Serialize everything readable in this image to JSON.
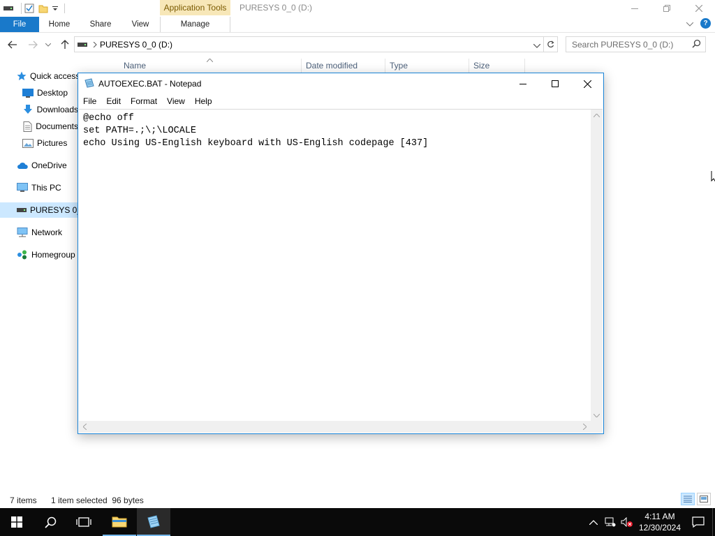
{
  "explorer": {
    "title": "PURESYS 0_0 (D:)",
    "contextual_tab": "Application Tools",
    "ribbon_tabs": [
      "File",
      "Home",
      "Share",
      "View",
      "Manage"
    ],
    "address": "PURESYS 0_0 (D:)",
    "search_placeholder": "Search PURESYS 0_0 (D:)",
    "columns": [
      "Name",
      "Date modified",
      "Type",
      "Size"
    ],
    "nav_items": [
      {
        "label": "Quick access",
        "icon": "star-icon"
      },
      {
        "label": "Desktop",
        "icon": "desktop-icon"
      },
      {
        "label": "Downloads",
        "icon": "download-icon"
      },
      {
        "label": "Documents",
        "icon": "documents-icon"
      },
      {
        "label": "Pictures",
        "icon": "pictures-icon"
      },
      {
        "label": "OneDrive",
        "icon": "cloud-icon"
      },
      {
        "label": "This PC",
        "icon": "computer-icon"
      },
      {
        "label": "PURESYS 0_0 (D:)",
        "icon": "drive-icon"
      },
      {
        "label": "Network",
        "icon": "network-icon"
      },
      {
        "label": "Homegroup",
        "icon": "homegroup-icon"
      }
    ],
    "status_items": "7 items",
    "status_selected": "1 item selected  96 bytes"
  },
  "notepad": {
    "title": "AUTOEXEC.BAT - Notepad",
    "menu": [
      "File",
      "Edit",
      "Format",
      "View",
      "Help"
    ],
    "content": "@echo off\nset PATH=.;\\;\\LOCALE\necho Using US-English keyboard with US-English codepage [437]"
  },
  "taskbar": {
    "time": "4:11 AM",
    "date": "12/30/2024"
  },
  "colors": {
    "accent": "#1979ca",
    "selection": "#cce8ff",
    "taskbar": "#0a0a0a"
  }
}
